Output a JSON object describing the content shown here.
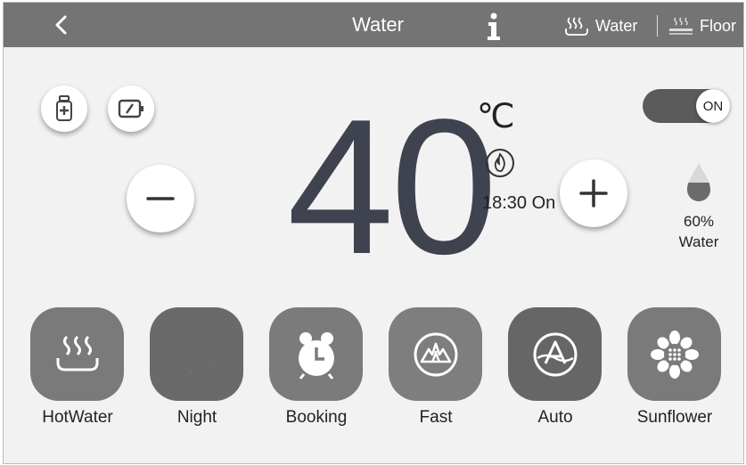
{
  "header": {
    "title": "Water",
    "tabs": [
      {
        "label": "Water",
        "icon": "hot-water-icon"
      },
      {
        "label": "Floor",
        "icon": "floor-heating-icon"
      }
    ]
  },
  "temperature": {
    "value": "40",
    "unit": "℃",
    "schedule": "18:30 On"
  },
  "power": {
    "label": "ON",
    "state": "on"
  },
  "water_level": {
    "percent": "60%",
    "label": "Water"
  },
  "modes": [
    {
      "label": "HotWater",
      "icon": "hot-water-icon",
      "bg": "#7a7a7a"
    },
    {
      "label": "Night",
      "icon": "moon-icon",
      "bg": "#6a6a6a"
    },
    {
      "label": "Booking",
      "icon": "alarm-clock-icon",
      "bg": "#7b7b7b"
    },
    {
      "label": "Fast",
      "icon": "fast-flame-icon",
      "bg": "#7e7e7e"
    },
    {
      "label": "Auto",
      "icon": "auto-icon",
      "bg": "#666666"
    },
    {
      "label": "Sunflower",
      "icon": "sunflower-icon",
      "bg": "#7a7a7a"
    }
  ],
  "colors": {
    "header": "#747474",
    "background": "#f2f2f2",
    "toggle": "#5b5b5b"
  }
}
